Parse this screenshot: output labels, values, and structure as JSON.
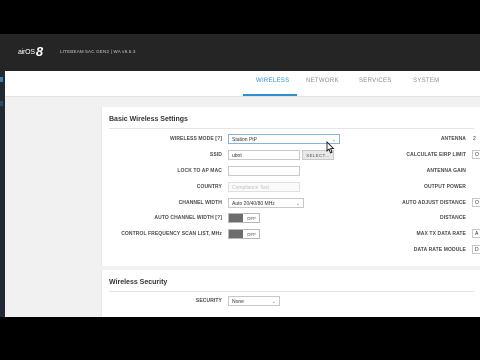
{
  "header": {
    "logo_text": "airOS",
    "logo_version": "8",
    "device_info": "LITEBEAM 5AC GEN2 | WA v8.5.3"
  },
  "tabs": [
    {
      "label": "WIRELESS",
      "active": true
    },
    {
      "label": "NETWORK",
      "active": false
    },
    {
      "label": "SERVICES",
      "active": false
    },
    {
      "label": "SYSTEM",
      "active": false
    }
  ],
  "basic_wireless": {
    "title": "Basic Wireless Settings",
    "wireless_mode": {
      "label": "WIRELESS MODE [?]",
      "value": "Station PtP"
    },
    "ssid": {
      "label": "SSID",
      "value": "ubnt",
      "button": "SELECT..."
    },
    "lock_to_ap_mac": {
      "label": "LOCK TO AP MAC",
      "value": ""
    },
    "country": {
      "label": "COUNTRY",
      "value": "Compliance Test"
    },
    "channel_width": {
      "label": "CHANNEL WIDTH",
      "value": "Auto 20/40/80 MHz"
    },
    "auto_channel_width": {
      "label": "AUTO CHANNEL WIDTH [?]",
      "state": "OFF"
    },
    "control_freq_scan": {
      "label": "CONTROL FREQUENCY SCAN LIST, MHz",
      "state": "OFF"
    },
    "right": {
      "antenna": {
        "label": "ANTENNA",
        "value": "2"
      },
      "calculate_eirp": {
        "label": "CALCULATE EIRP LIMIT",
        "value": "O"
      },
      "antenna_gain": {
        "label": "ANTENNA GAIN"
      },
      "output_power": {
        "label": "OUTPUT POWER"
      },
      "auto_adjust_distance": {
        "label": "AUTO ADJUST DISTANCE",
        "value": "O"
      },
      "distance": {
        "label": "DISTANCE"
      },
      "max_tx_data_rate": {
        "label": "MAX TX DATA RATE",
        "value": "A"
      },
      "data_rate_module": {
        "label": "DATA RATE MODULE",
        "value": "D"
      }
    }
  },
  "wireless_security": {
    "title": "Wireless Security",
    "security": {
      "label": "SECURITY",
      "value": "None"
    }
  },
  "colors": {
    "accent": "#2f8fcf",
    "header_bg": "#252525",
    "page_bg": "#f1f1f1"
  }
}
